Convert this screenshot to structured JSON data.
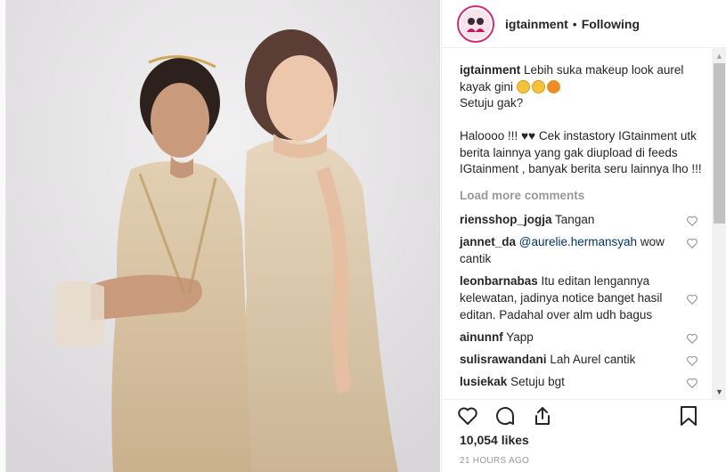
{
  "header": {
    "username": "igtainment",
    "separator": "•",
    "follow_status": "Following"
  },
  "caption": {
    "username": "igtainment",
    "line1": "Lebih suka makeup look aurel kayak gini",
    "line2": "Setuju gak?",
    "line3": "Haloooo !!! ♥♥ Cek instastory IGtainment utk berita lainnya yang gak diupload di feeds IGtainment , banyak berita seru lainnya lho !!!"
  },
  "load_more": "Load more comments",
  "comments": [
    {
      "user": "riensshop_jogja",
      "text": "Tangan"
    },
    {
      "user": "jannet_da",
      "mention": "@aurelie.hermansyah",
      "text": "wow cantik"
    },
    {
      "user": "leonbarnabas",
      "text": "Itu editan lengannya kelewatan, jadinya notice banget hasil editan. Padahal over alm udh bagus"
    },
    {
      "user": "ainunnf",
      "text": "Yapp"
    },
    {
      "user": "sulisrawandani",
      "text": "Lah Aurel cantik"
    },
    {
      "user": "lusiekak",
      "text": "Setuju bgt"
    }
  ],
  "likes": "10,054 likes",
  "timestamp": "21 HOURS AGO",
  "icons": [
    "heart-icon",
    "comment-icon",
    "share-icon",
    "bookmark-icon",
    "like-heart-icon"
  ],
  "colors": {
    "accent_link": "#003569",
    "muted": "#999999",
    "photo_bg": "#e9e7e8",
    "dress": "#d9c3a3"
  }
}
